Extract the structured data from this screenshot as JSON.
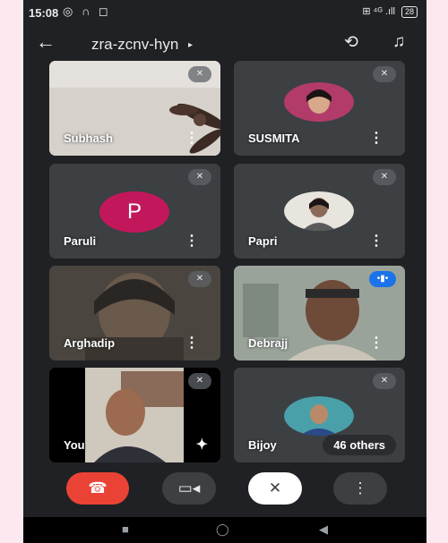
{
  "status_bar": {
    "time": "15:08",
    "icons": "◎ ∩ ◻",
    "network": "⊞ ⁴ᴳ .ıll",
    "battery": "28"
  },
  "header": {
    "back_glyph": "←",
    "meeting_code": "zra-zcnv-hyn",
    "caret": "▸",
    "switch_camera_glyph": "⟲",
    "audio_glyph": "♫"
  },
  "tiles": [
    {
      "name": "Subhash",
      "more": "⋮",
      "muted_glyph": "✕"
    },
    {
      "name": "SUSMITA",
      "more": "⋮",
      "muted_glyph": "✕"
    },
    {
      "name": "Paruli",
      "avatar_letter": "P",
      "more": "⋮",
      "muted_glyph": "✕"
    },
    {
      "name": "Papri",
      "more": "⋮",
      "muted_glyph": "✕"
    },
    {
      "name": "Arghadip",
      "more": "⋮",
      "muted_glyph": "✕"
    },
    {
      "name": "Debrajj",
      "more": "⋮",
      "speaking_glyph": "•▮•"
    },
    {
      "name": "You",
      "effects_glyph": "✦",
      "muted_glyph": "✕"
    },
    {
      "name": "Bijoy",
      "others_label": "46 others",
      "muted_glyph": "✕"
    }
  ],
  "controls": {
    "end_call": "☎",
    "camera": "▭◂",
    "mic": "✕",
    "more": "⋮"
  },
  "nav_bar": {
    "recents": "■",
    "home": "◯",
    "back": "◀"
  },
  "colors": {
    "end_call": "#ea4335",
    "avatar_p": "#c2185b",
    "speaking": "#1a73e8",
    "background": "#202124"
  }
}
